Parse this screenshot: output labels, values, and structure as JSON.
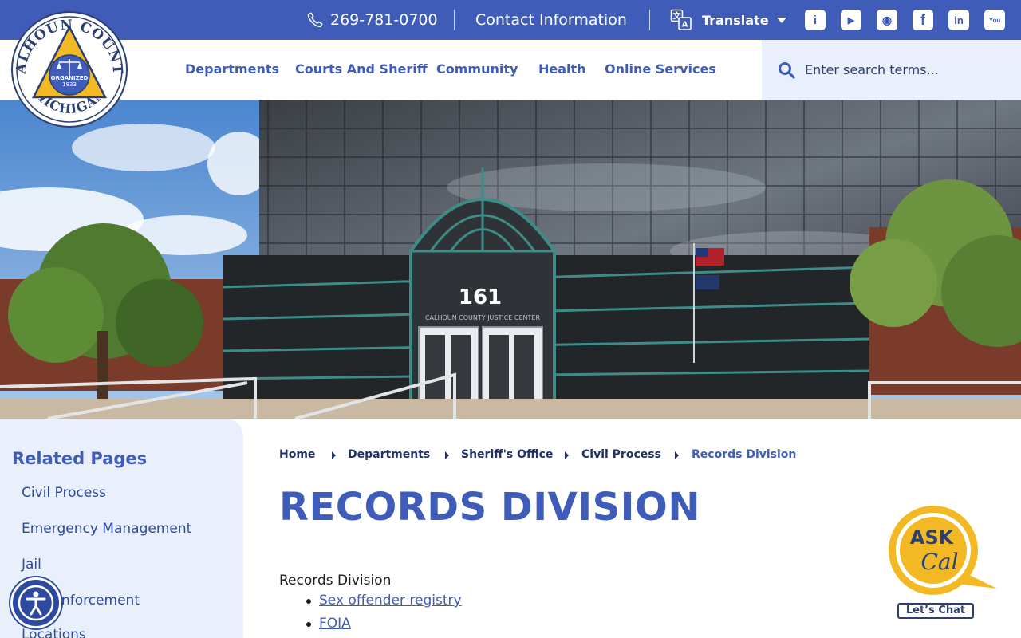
{
  "topbar": {
    "phone": "269-781-0700",
    "contact": "Contact Information",
    "translate": "Translate",
    "social": [
      {
        "name": "info-icon",
        "glyph": "i"
      },
      {
        "name": "youtube-play-icon",
        "glyph": "▶"
      },
      {
        "name": "podcast-icon",
        "glyph": "◉"
      },
      {
        "name": "facebook-icon",
        "glyph": "f"
      },
      {
        "name": "linkedin-icon",
        "glyph": "in"
      },
      {
        "name": "youtube-icon",
        "glyph": "You"
      }
    ]
  },
  "logo": {
    "top_text": "CALHOUN COUNTY",
    "bottom_text": "MICHIGAN",
    "seal_line1": "ORGANIZED",
    "seal_line2": "1833"
  },
  "nav": {
    "items": [
      "Departments",
      "Courts And Sheriff",
      "Community",
      "Health",
      "Online Services"
    ],
    "search_placeholder": "Enter search terms..."
  },
  "hero": {
    "building_number": "161",
    "sign_text": "CALHOUN COUNTY JUSTICE CENTER"
  },
  "sidebar": {
    "title": "Related Pages",
    "links": [
      "Civil Process",
      "Emergency Management",
      "Jail",
      "Law Enforcement",
      "Locations"
    ]
  },
  "breadcrumb": [
    "Home",
    "Departments",
    "Sheriff's Office",
    "Civil Process",
    "Records Division"
  ],
  "page": {
    "title": "RECORDS DIVISION",
    "intro": "Records Division",
    "links": [
      "Sex offender registry",
      "FOIA"
    ]
  },
  "askcal": {
    "ask": "ASK",
    "cal": "Cal",
    "chat": "Let’s Chat"
  },
  "colors": {
    "brand_blue": "#3f5db8",
    "navy": "#2b3f73",
    "gold": "#f2b924",
    "panel": "#e9f0fb"
  }
}
